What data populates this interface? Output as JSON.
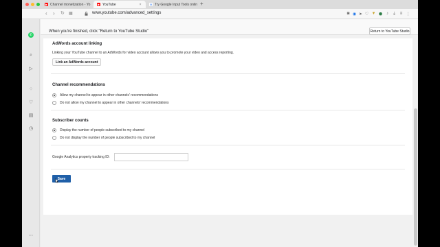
{
  "browser": {
    "tabs": [
      {
        "label": "Channel monetization - Yo",
        "favicon": "youtube-icon"
      },
      {
        "label": "YouTube",
        "favicon": "youtube-icon",
        "active": true
      },
      {
        "label": "Try Google Input Tools onlin",
        "favicon": "google-icon"
      }
    ],
    "new_tab": "+",
    "url": "www.youtube.com/advanced_settings"
  },
  "studio_bar": {
    "message": "When you're finished, click \"Return to YouTube Studio\"",
    "button_label": "Return to YouTube Studio"
  },
  "adwords": {
    "heading": "AdWords account linking",
    "description": "Linking your YouTube channel to an AdWords for video account allows you to promote your video and access reporting.",
    "button_label": "Link an AdWords account"
  },
  "recommendations": {
    "heading": "Channel recommendations",
    "options": [
      {
        "label": "Allow my channel to appear in other channels' recommendations",
        "selected": true
      },
      {
        "label": "Do not allow my channel to appear in other channels' recommendations",
        "selected": false
      }
    ]
  },
  "subscribers": {
    "heading": "Subscriber counts",
    "options": [
      {
        "label": "Display the number of people subscribed to my channel",
        "selected": true
      },
      {
        "label": "Do not display the number of people subscribed to my channel",
        "selected": false
      }
    ]
  },
  "analytics": {
    "label": "Google Analytics property tracking ID:",
    "value": ""
  },
  "save_label": "Save",
  "colors": {
    "accent": "#1f5fa8",
    "youtube_red": "#ff0000",
    "whatsapp_green": "#25d366"
  }
}
